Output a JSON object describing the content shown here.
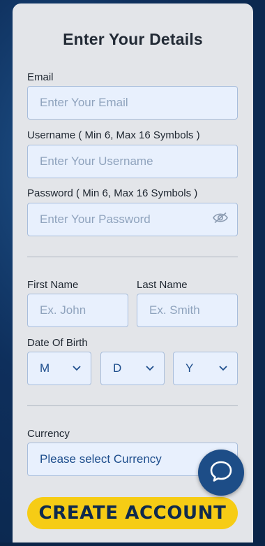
{
  "form": {
    "title": "Enter Your Details",
    "email": {
      "label": "Email",
      "placeholder": "Enter Your Email"
    },
    "username": {
      "label": "Username ( Min 6, Max 16 Symbols )",
      "placeholder": "Enter Your Username"
    },
    "password": {
      "label": "Password ( Min 6, Max 16 Symbols )",
      "placeholder": "Enter Your Password",
      "toggle_icon": "eye-slash-icon"
    },
    "first_name": {
      "label": "First Name",
      "placeholder": "Ex. John"
    },
    "last_name": {
      "label": "Last Name",
      "placeholder": "Ex. Smith"
    },
    "dob": {
      "label": "Date Of Birth",
      "month": "M",
      "day": "D",
      "year": "Y"
    },
    "currency": {
      "label": "Currency",
      "value": "Please select Currency"
    },
    "submit_label": "CREATE ACCOUNT"
  },
  "chat_widget": {
    "icon": "chat-bubble-icon",
    "color": "#1d4d87"
  },
  "colors": {
    "panel": "#e3e5e9",
    "field_bg": "#e8f0fd",
    "field_border": "#a8bddb",
    "button": "#f6cc15",
    "button_text": "#0f2a4d",
    "background": "#0e2f5c"
  }
}
